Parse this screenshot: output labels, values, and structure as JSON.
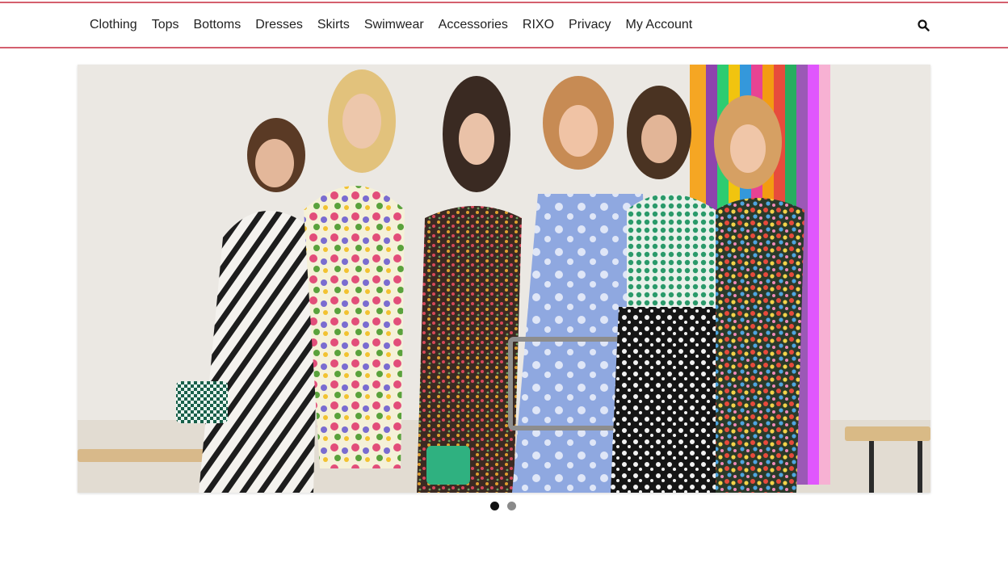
{
  "nav": {
    "items": [
      {
        "label": "Clothing"
      },
      {
        "label": "Tops"
      },
      {
        "label": "Bottoms"
      },
      {
        "label": "Dresses"
      },
      {
        "label": "Skirts"
      },
      {
        "label": "Swimwear"
      },
      {
        "label": "Accessories"
      },
      {
        "label": "RIXO"
      },
      {
        "label": "Privacy"
      },
      {
        "label": "My Account"
      }
    ],
    "search_icon": "search-icon"
  },
  "slider": {
    "slide_count": 2,
    "active_index": 0
  },
  "colors": {
    "nav_border": "#d4606e",
    "dot_active": "#111111",
    "dot_inactive": "#8a8a8a"
  }
}
